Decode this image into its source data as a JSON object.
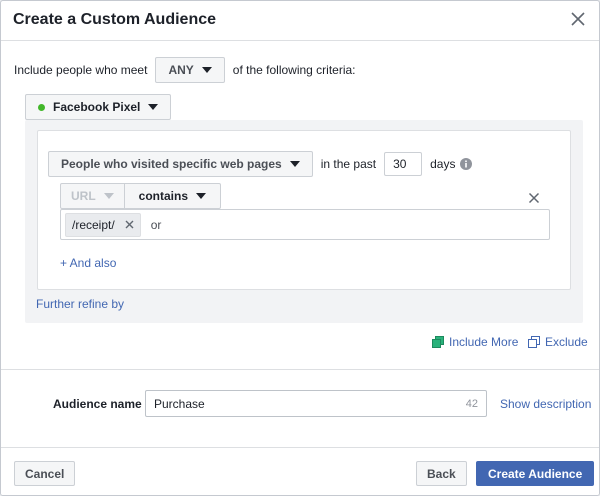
{
  "dialog": {
    "title": "Create a Custom Audience"
  },
  "criteria": {
    "prefix": "Include people who meet",
    "match_value": "ANY",
    "suffix": "of the following criteria:"
  },
  "source": {
    "label": "Facebook Pixel",
    "status_color": "#42b72a"
  },
  "rule": {
    "visitor_option": "People who visited specific web pages",
    "in_the_past_label": "in the past",
    "days_value": "30",
    "days_label": "days",
    "field_label": "URL",
    "operator_label": "contains",
    "tokens": [
      "/receipt/"
    ],
    "token_connector": "or",
    "and_also_label": "+ And also"
  },
  "further_refine_label": "Further refine by",
  "actions": {
    "include_more_label": "Include More",
    "exclude_label": "Exclude"
  },
  "audience_name": {
    "label": "Audience name",
    "value": "Purchase",
    "remaining_chars": "42",
    "show_description_label": "Show description"
  },
  "footer": {
    "cancel_label": "Cancel",
    "back_label": "Back",
    "create_label": "Create Audience"
  },
  "colors": {
    "primary": "#4267b2",
    "link": "#4267b2",
    "panel_bg": "#f2f3f5"
  }
}
